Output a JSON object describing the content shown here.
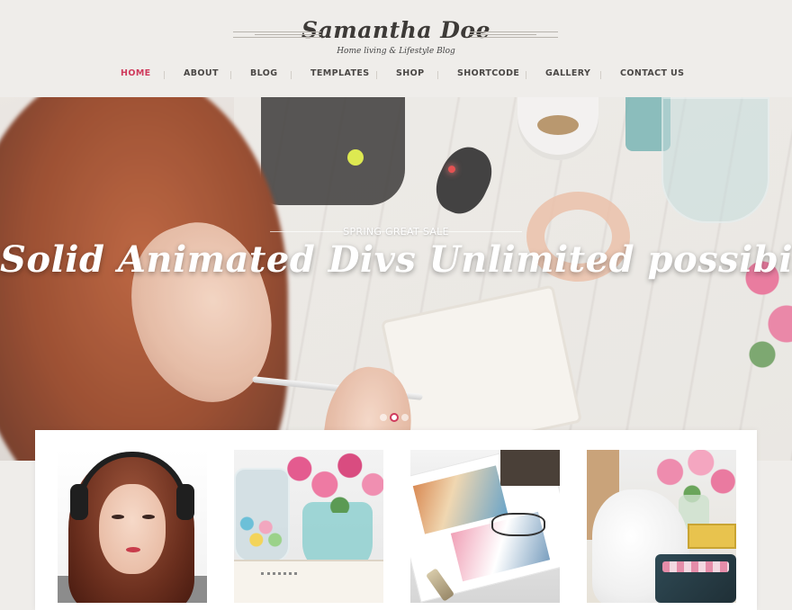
{
  "header": {
    "logo_title": "Samantha Doe",
    "tagline": "Home living & Lifestyle Blog"
  },
  "nav": {
    "items": [
      {
        "label": "HOME",
        "active": true
      },
      {
        "label": "ABOUT",
        "active": false
      },
      {
        "label": "BLOG",
        "active": false
      },
      {
        "label": "TEMPLATES",
        "active": false
      },
      {
        "label": "SHOP",
        "active": false
      },
      {
        "label": "SHORTCODE",
        "active": false
      },
      {
        "label": "GALLERY",
        "active": false
      },
      {
        "label": "CONTACT US",
        "active": false
      }
    ]
  },
  "slider": {
    "subtitle": "SPRING GREAT SALE",
    "title": "Solid Animated Divs Unlimited possibilities",
    "dot_count": 3,
    "active_dot": 1
  },
  "cards": [
    {
      "subject": "girl-with-headphones-photo"
    },
    {
      "subject": "jar-and-flowers-photo"
    },
    {
      "subject": "magazine-photo"
    },
    {
      "subject": "lilies-and-veil-photo"
    }
  ],
  "colors": {
    "accent": "#cf3a5c",
    "background": "#efedea",
    "nav_text": "#4a4745"
  }
}
